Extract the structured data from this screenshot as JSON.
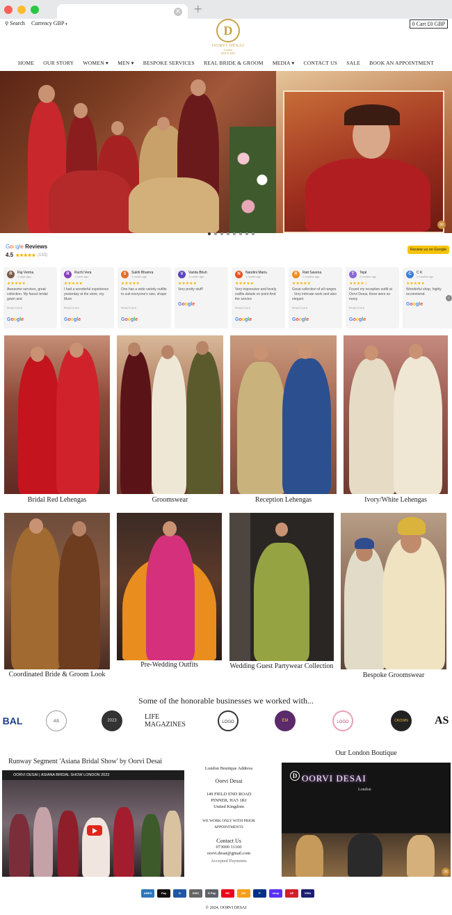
{
  "browser": {
    "new_tab": "+",
    "tab_close": "×"
  },
  "topbar": {
    "search_label": "Search",
    "currency_label": "Currency",
    "currency_value": "GBP",
    "cart_label": "0 Cart £0 GBP"
  },
  "logo": {
    "mark": "D",
    "name": "OORVI DESAI",
    "sub": "London",
    "since": "SINCE 2003"
  },
  "nav": [
    "HOME",
    "OUR STORY",
    "WOMEN",
    "MEN",
    "BESPOKE SERVICES",
    "REAL BRIDE & GROOM",
    "MEDIA",
    "CONTACT US",
    "SALE",
    "BOOK AN APPOINTMENT"
  ],
  "reviews": {
    "brand": "Google",
    "title": "Reviews",
    "rating": "4.5",
    "stars": "★★★★★",
    "count": "(133)",
    "button": "Review us on Google",
    "cards": [
      {
        "initial": "R",
        "color": "#7a5a48",
        "name": "Raj Verma",
        "date": "2 days ago",
        "stars": "★★★★★",
        "text": "Awesome services, great collection. My fiancé bridal gown and",
        "more": "Read more"
      },
      {
        "initial": "R",
        "color": "#8a3dbd",
        "name": "Ruchi Vera",
        "date": "1 week ago",
        "stars": "★★★★★",
        "text": "I had a wonderful experience yesterday at the store, my Mum",
        "more": "Read more"
      },
      {
        "initial": "S",
        "color": "#e56a24",
        "name": "Sukhi Bhamra",
        "date": "1 month ago",
        "stars": "★★★★★",
        "text": "One has a wide variety outfits to suit everyone's size, shape",
        "more": "Read more"
      },
      {
        "initial": "V",
        "color": "#5b45c2",
        "name": "Vanita Bhuh",
        "date": "1 month ago",
        "stars": "★★★★★",
        "text": "Very pretty stuff!",
        "more": ""
      },
      {
        "initial": "N",
        "color": "#e5541e",
        "name": "Nandini Mariu",
        "date": "1 month ago",
        "stars": "★★★★★",
        "text": "Very impressive and lovely outfits details on point And the service",
        "more": "Read more"
      },
      {
        "initial": "R",
        "color": "#f08a1c",
        "name": "Rati Saxena",
        "date": "2 months ago",
        "stars": "★★★★★",
        "text": "Great collection of all ranges . Very intricate work and also elegant",
        "more": "Read more"
      },
      {
        "initial": "T",
        "color": "#8a69d6",
        "name": "Tejal",
        "date": "2 months ago",
        "stars": "★★★★☆",
        "text": "Found my reception outfit at Oorvi Desai, there were so many",
        "more": "Read more"
      },
      {
        "initial": "C",
        "color": "#3f7fd8",
        "name": "C K",
        "date": "2 months ago",
        "stars": "★★★★★",
        "text": "Wonderful shop, highly recommend.",
        "more": ""
      }
    ]
  },
  "categories": [
    "Bridal Red Lehengas",
    "Groomswear",
    "Reception Lehengas",
    "Ivory/White Lehengas",
    "Coordinated Bride & Groom Look",
    "Pre-Wedding Outfits",
    "Wedding Guest Partywear Collection",
    "Bespoke Groomswear"
  ],
  "businesses": {
    "title": "Some of the honorable businesses we worked with...",
    "logos": [
      "BAL",
      "AS",
      "2023",
      "LIFE MAGAZINES",
      "LOGO",
      "EM",
      "LOGO",
      "CROWN",
      "AS"
    ]
  },
  "runway": {
    "title": "Runway Segment 'Asiana Bridal Show' by Oorvi Desai",
    "video_title": "OORVI DESAI | ASIANA BRIDAL SHOW LONDON 2023"
  },
  "address": {
    "heading": "London Boutique Address",
    "name": "Oorvi Desai",
    "line1": "149 FIELD END ROAD",
    "line2": "PINNER, HA5 1RJ",
    "line3": "United Kingdom",
    "note": "WE WORK ONLY WITH PRIOR APPOINTMENTS",
    "contact_heading": "Contact Us",
    "phone": "073000 11160",
    "email": "oorvi.desai@gmail.com",
    "payments_heading": "Accepted Payments"
  },
  "boutique": {
    "title": "Our London Boutique",
    "sign": "OORVI DESAI",
    "sign_sub": "London"
  },
  "payments": [
    {
      "label": "AMEX",
      "color": "#2e77bb"
    },
    {
      "label": "Pay",
      "color": "#111111"
    },
    {
      "label": "D",
      "color": "#1f57a4"
    },
    {
      "label": "DISC",
      "color": "#666666"
    },
    {
      "label": "G Pay",
      "color": "#5f6368"
    },
    {
      "label": "MC",
      "color": "#eb001b"
    },
    {
      "label": "MC",
      "color": "#f79e1b"
    },
    {
      "label": "P",
      "color": "#003087"
    },
    {
      "label": "shop",
      "color": "#5a31f4"
    },
    {
      "label": "UP",
      "color": "#d21f2d"
    },
    {
      "label": "VISA",
      "color": "#1a1f71"
    }
  ],
  "copyright": "© 2024, OORVI DESAI"
}
